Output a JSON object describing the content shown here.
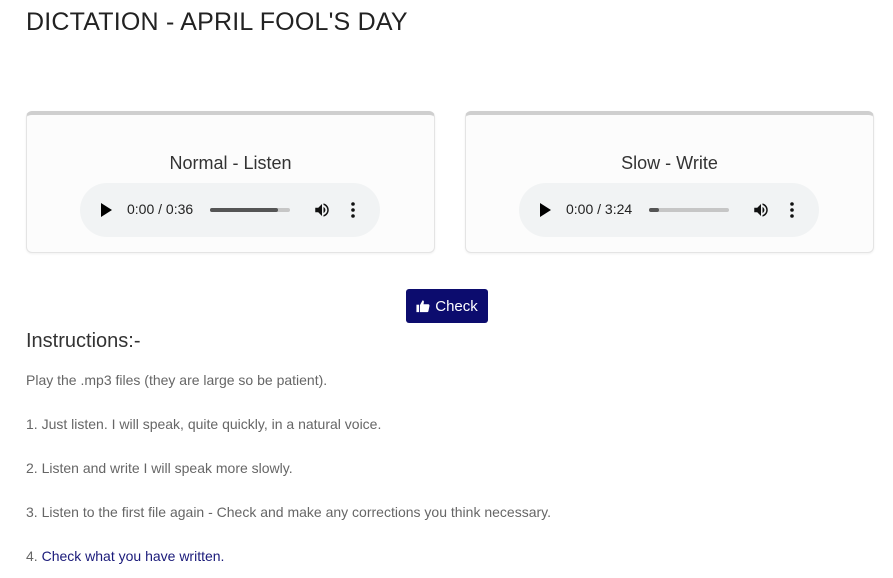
{
  "page": {
    "title": "DICTATION - APRIL FOOL'S DAY"
  },
  "cards": [
    {
      "title": "Normal - Listen",
      "player": {
        "current": "0:00",
        "duration": "0:36",
        "progress": 0.85
      }
    },
    {
      "title": "Slow - Write",
      "player": {
        "current": "0:00",
        "duration": "3:24",
        "progress": 0.12
      }
    }
  ],
  "check_button": {
    "label": "Check",
    "icon": "thumbs-up-icon"
  },
  "instructions": {
    "heading": "Instructions:-",
    "intro": "Play the .mp3 files (they are large so be patient).",
    "step1": "1. Just listen. I will speak, quite quickly, in a natural voice.",
    "step2": "2. Listen and write I will speak more slowly.",
    "step3": "3. Listen to the first file again - Check and make any corrections you think necessary.",
    "step4_prefix": "4. ",
    "step4_link": "Check what you have written."
  },
  "colors": {
    "button_bg": "#0c0c6e",
    "link": "#1a1a7a",
    "player_bg": "#f1f3f4"
  }
}
